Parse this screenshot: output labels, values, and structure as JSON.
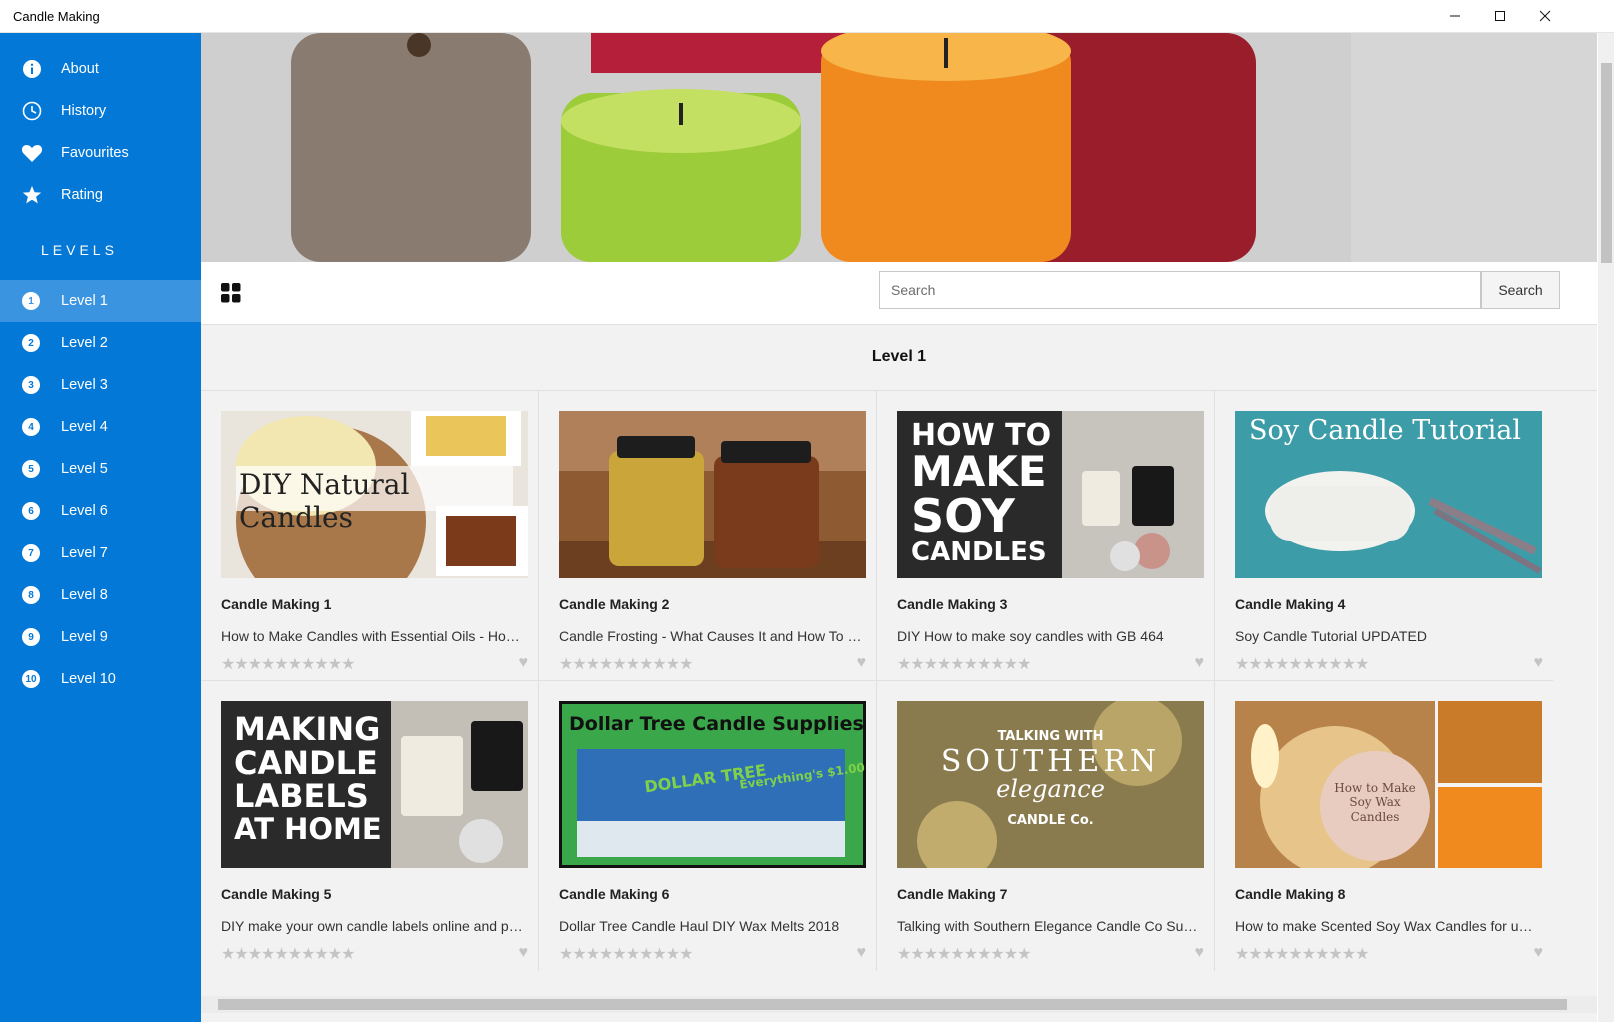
{
  "window": {
    "title": "Candle Making",
    "minimize": "—",
    "maximize": "☐",
    "close": "✕"
  },
  "sidebar": {
    "items": [
      {
        "label": "About",
        "icon": "info-icon"
      },
      {
        "label": "History",
        "icon": "history-icon"
      },
      {
        "label": "Favourites",
        "icon": "heart-icon"
      },
      {
        "label": "Rating",
        "icon": "star-icon"
      }
    ],
    "levels_heading": "LEVELS",
    "levels": [
      {
        "num": "1",
        "label": "Level 1"
      },
      {
        "num": "2",
        "label": "Level 2"
      },
      {
        "num": "3",
        "label": "Level 3"
      },
      {
        "num": "4",
        "label": "Level 4"
      },
      {
        "num": "5",
        "label": "Level 5"
      },
      {
        "num": "6",
        "label": "Level 6"
      },
      {
        "num": "7",
        "label": "Level 7"
      },
      {
        "num": "8",
        "label": "Level 8"
      },
      {
        "num": "9",
        "label": "Level 9"
      },
      {
        "num": "10",
        "label": "Level 10"
      }
    ],
    "active_level": "Level 1"
  },
  "toolbar": {
    "search_placeholder": "Search",
    "search_button": "Search"
  },
  "main": {
    "section_title": "Level 1"
  },
  "colors": {
    "accent": "#0478d7",
    "active": "#3a94e0"
  },
  "cards": [
    {
      "title": "Candle Making 1",
      "desc": "How to Make Candles with Essential Oils - How to Make Natural Candles",
      "stars": "★★★★★★★★★★",
      "overlay": "DIY Natural Candles"
    },
    {
      "title": "Candle Making 2",
      "desc": "Candle Frosting - What Causes It and How To Prevent It",
      "stars": "★★★★★★★★★★"
    },
    {
      "title": "Candle Making 3",
      "desc": "DIY How to make soy candles with GB 464",
      "stars": "★★★★★★★★★★",
      "overlay": [
        "HOW TO",
        "MAKE",
        "SOY",
        "CANDLES"
      ]
    },
    {
      "title": "Candle Making 4",
      "desc": "Soy Candle Tutorial UPDATED",
      "stars": "★★★★★★★★★★",
      "overlay": "Soy Candle Tutorial"
    },
    {
      "title": "Candle Making 5",
      "desc": "DIY make your own candle labels online and print at home",
      "stars": "★★★★★★★★★★",
      "overlay": [
        "MAKING",
        "CANDLE",
        "LABELS",
        "AT HOME"
      ]
    },
    {
      "title": "Candle Making 6",
      "desc": "Dollar Tree Candle Haul DIY Wax Melts 2018",
      "stars": "★★★★★★★★★★",
      "overlay": "Dollar Tree Candle Supplies",
      "overlay2": "DOLLAR TREE",
      "overlay3": "Everything's $1.00"
    },
    {
      "title": "Candle Making 7",
      "desc": "Talking with Southern Elegance Candle Co Success Story",
      "stars": "★★★★★★★★★★",
      "overlay": [
        "TALKING WITH",
        "SOUTHERN",
        "elegance",
        "CANDLE Co."
      ]
    },
    {
      "title": "Candle Making 8",
      "desc": "How to make Scented Soy Wax Candles for under a dollar",
      "stars": "★★★★★★★★★★",
      "overlay": [
        "How to Make",
        "Soy Wax",
        "Candles"
      ]
    }
  ]
}
